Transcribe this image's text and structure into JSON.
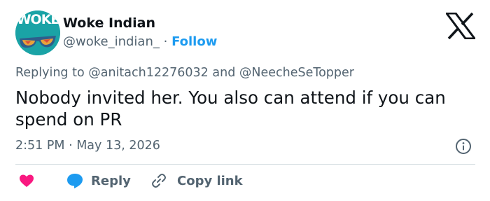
{
  "author": {
    "avatar_text": "WOKE",
    "display_name": "Woke Indian",
    "handle": "@woke_indian_",
    "separator": "·",
    "follow_label": "Follow"
  },
  "reply_context": {
    "prefix": "Replying to",
    "mention_1": "@anitach12276032",
    "conjunction": "and",
    "mention_2": "@NeecheSeTopper"
  },
  "tweet": {
    "text": "Nobody invited her. You also can attend if you can spend on PR",
    "timestamp": "2:51 PM · May 13, 2026"
  },
  "actions": {
    "like_icon": "heart-icon",
    "reply_label": "Reply",
    "copy_link_label": "Copy link"
  },
  "colors": {
    "accent": "#1d9bf0",
    "like": "#f91880",
    "secondary_text": "#536471",
    "avatar_bg": "#1aa3a6"
  }
}
